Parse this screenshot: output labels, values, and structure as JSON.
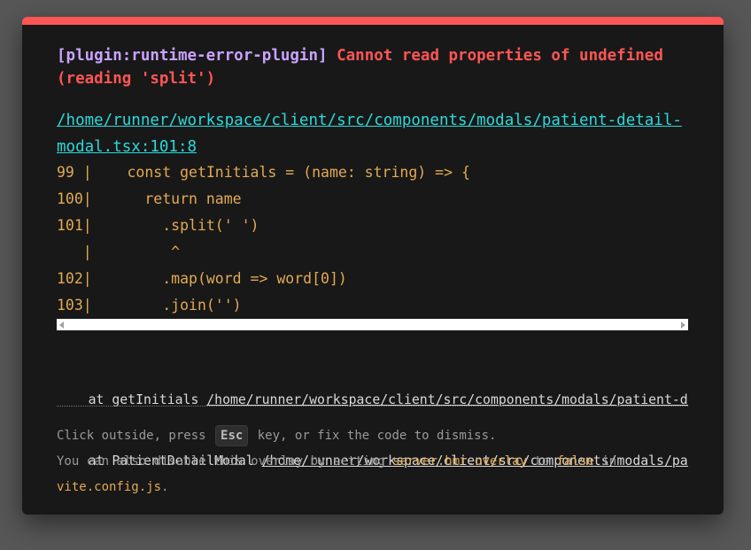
{
  "error": {
    "plugin": "[plugin:runtime-error-plugin]",
    "message": "Cannot read properties of undefined (reading 'split')",
    "file": "/home/runner/workspace/client/src/components/modals/patient-detail-modal.tsx:101:8"
  },
  "code_frame": [
    "99 |    const getInitials = (name: string) => {",
    "100|      return name",
    "101|        .split(' ')",
    "   |         ^",
    "102|        .map(word => word[0])",
    "103|        .join('')"
  ],
  "stack": [
    {
      "prefix": "    at getInitials ",
      "file": "/home/runner/workspace/client/src/components/modals/patient-detail-modal.tsx"
    },
    {
      "prefix": "    at PatientDetailModal ",
      "file": "/home/runner/workspace/client/src/components/modals/patient-detail-modal.tsx"
    }
  ],
  "tip": {
    "line1_a": "Click outside, press ",
    "key": "Esc",
    "line1_b": " key, or fix the code to dismiss.",
    "line2_a": "You can also disable this overlay by setting ",
    "setting": "server.hmr.overlay",
    "line2_b": " to ",
    "value": "false",
    "line2_c": " in ",
    "config": "vite.config.js",
    "line2_d": "."
  },
  "colors": {
    "accent_red": "#ff5555",
    "plugin": "#c9a3ff",
    "link": "#2dd9da",
    "code": "#e2aa53"
  }
}
